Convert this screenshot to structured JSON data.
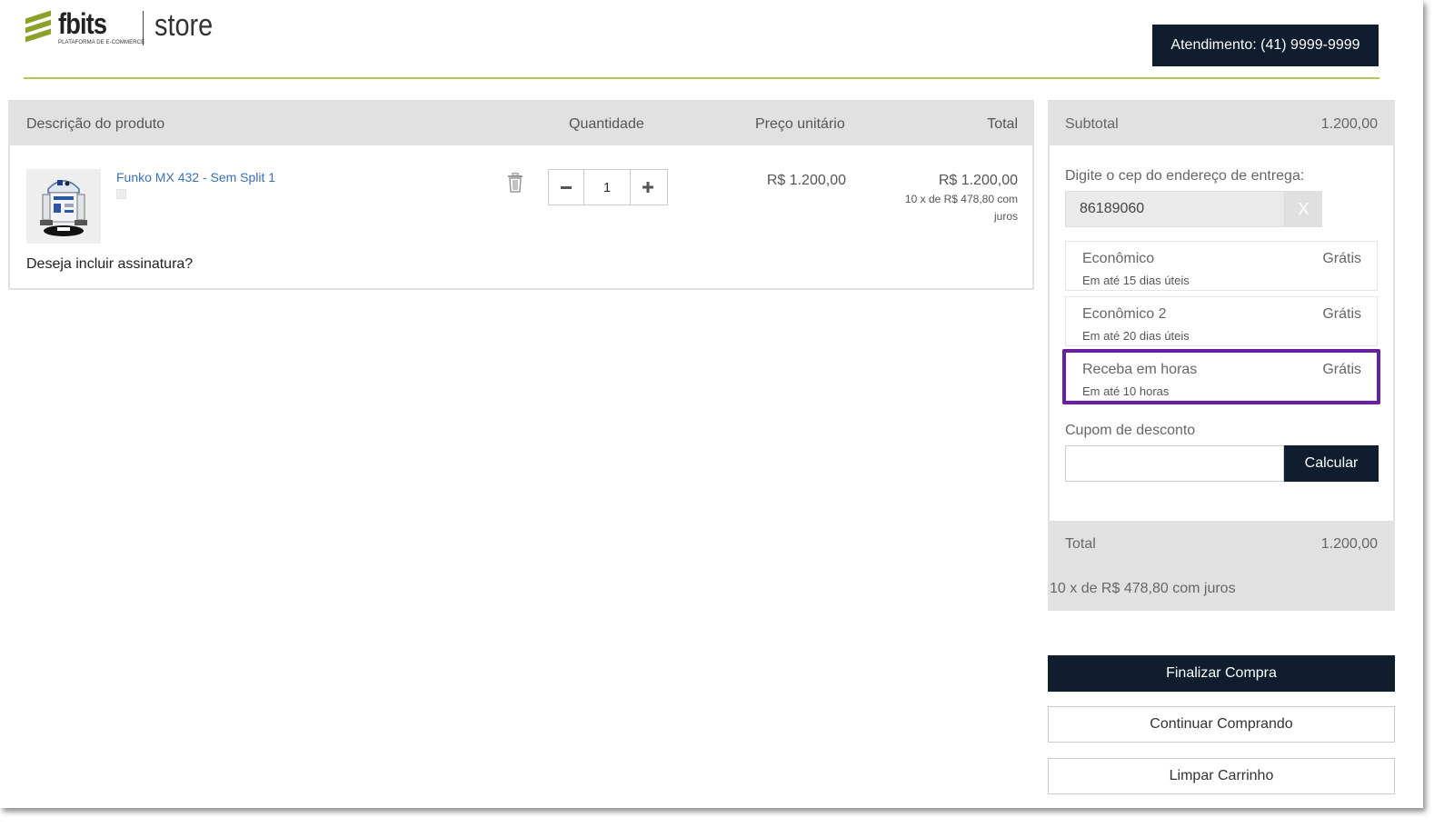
{
  "header": {
    "brand": "fbits",
    "tagline": "PLATAFORMA DE E-COMMERCE",
    "store": "store",
    "contact_button": "Atendimento: (41) 9999-9999",
    "accent_color": "#b5c552"
  },
  "cart": {
    "columns": {
      "description": "Descrição do produto",
      "quantity": "Quantidade",
      "unit_price": "Preço unitário",
      "total": "Total"
    },
    "items": [
      {
        "name": "Funko MX 432 - Sem Split 1",
        "image_icon": "funko-r2d2-image",
        "quantity": "1",
        "unit_price": "R$ 1.200,00",
        "total": "R$ 1.200,00",
        "installments": "10 x de R$ 478,80 com juros"
      }
    ],
    "subscription_question": "Deseja incluir assinatura?"
  },
  "summary": {
    "subtotal_label": "Subtotal",
    "subtotal_value": "1.200,00",
    "cep_label": "Digite o cep do endereço de entrega:",
    "cep_value": "86189060",
    "cep_clear": "X",
    "shipping_options": [
      {
        "name": "Econômico",
        "price": "Grátis",
        "eta": "Em até 15 dias úteis"
      },
      {
        "name": "Econômico 2",
        "price": "Grátis",
        "eta": "Em até 20 dias úteis"
      },
      {
        "name": "Receba em horas",
        "price": "Grátis",
        "eta": "Em até 10 horas",
        "highlighted": true
      }
    ],
    "highlight_color": "#6a1fa0",
    "coupon_label": "Cupom de desconto",
    "coupon_value": "",
    "coupon_button": "Calcular",
    "total_label": "Total",
    "total_value": "1.200,00",
    "installments": "10 x de R$ 478,80 com juros"
  },
  "actions": {
    "finish": "Finalizar Compra",
    "continue": "Continuar Comprando",
    "clear": "Limpar Carrinho",
    "primary_color": "#0f1d2e"
  }
}
